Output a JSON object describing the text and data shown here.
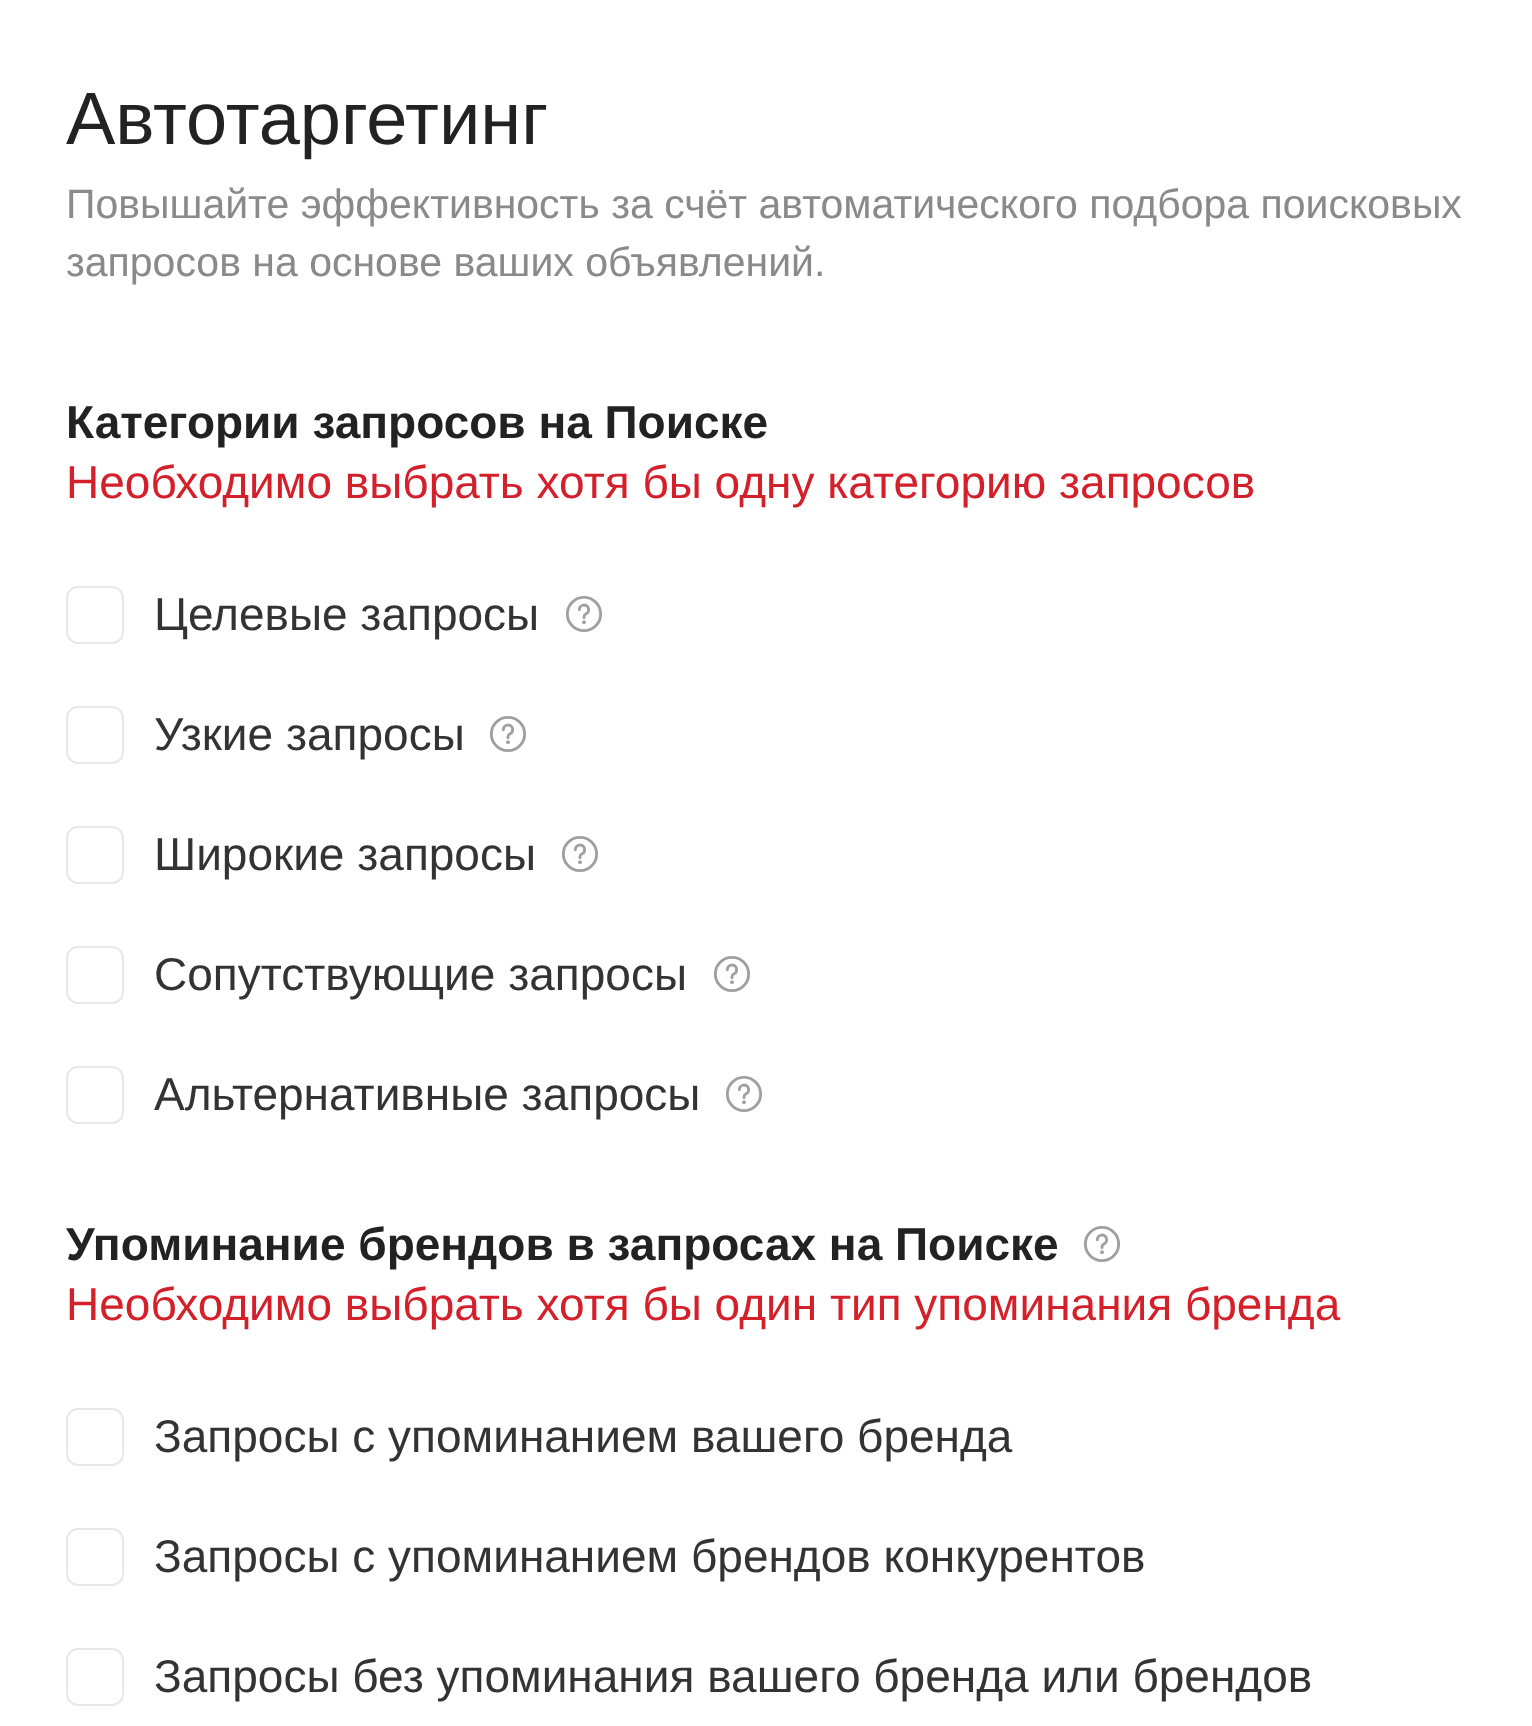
{
  "title": "Автотаргетинг",
  "description": "Повышайте эффективность за счёт автоматического подбора поисковых запросов на основе ваших объявлений.",
  "sections": [
    {
      "heading": "Категории запросов на Поиске",
      "help": false,
      "error": "Необходимо выбрать хотя бы одну категорию запросов",
      "options": [
        {
          "label": "Целевые запросы",
          "help": true,
          "checked": false
        },
        {
          "label": "Узкие запросы",
          "help": true,
          "checked": false
        },
        {
          "label": "Широкие запросы",
          "help": true,
          "checked": false
        },
        {
          "label": "Сопутствующие запросы",
          "help": true,
          "checked": false
        },
        {
          "label": "Альтернативные запросы",
          "help": true,
          "checked": false
        }
      ]
    },
    {
      "heading": "Упоминание брендов в запросах на Поиске",
      "help": true,
      "error": "Необходимо выбрать хотя бы один тип упоминания бренда",
      "options": [
        {
          "label": "Запросы с упоминанием вашего бренда",
          "help": false,
          "checked": false
        },
        {
          "label": "Запросы с упоминанием брендов конкурентов",
          "help": false,
          "checked": false
        },
        {
          "label": "Запросы без упоминания вашего бренда или брендов",
          "help": false,
          "checked": false
        }
      ]
    }
  ]
}
